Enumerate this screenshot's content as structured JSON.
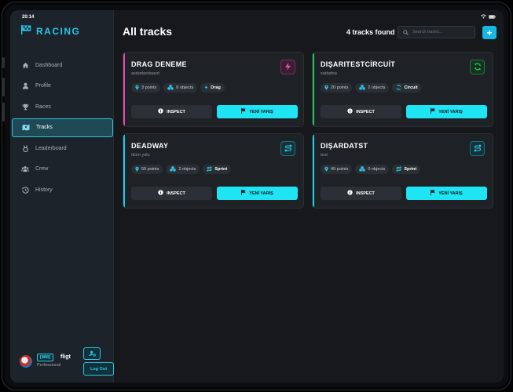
{
  "status": {
    "time": "20:14"
  },
  "brand": {
    "title": "RACING"
  },
  "sidebar": {
    "items": [
      {
        "label": "Dashboard",
        "icon": "home-icon"
      },
      {
        "label": "Profile",
        "icon": "user-icon"
      },
      {
        "label": "Races",
        "icon": "trophy-icon"
      },
      {
        "label": "Tracks",
        "icon": "map-icon",
        "active": true
      },
      {
        "label": "Leaderboard",
        "icon": "medal-icon"
      },
      {
        "label": "Crew",
        "icon": "crew-icon"
      },
      {
        "label": "History",
        "icon": "history-icon"
      }
    ]
  },
  "user": {
    "tag": "[888]",
    "name": "fligt",
    "rank": "Professional",
    "logout_label": "Log Out"
  },
  "header": {
    "title": "All tracks",
    "count_text": "4 tracks found",
    "search_placeholder": "Search tracks...",
    "add_label": "+"
  },
  "tracks": [
    {
      "name": "DRAG DENEME",
      "description": "asdadasdaasd",
      "points": "3 points",
      "objects": "8 objects",
      "type": "Drag",
      "type_icon": "bolt-icon",
      "accent": "#e04bb0"
    },
    {
      "name": "DIŞARITESTCİRCUİT",
      "description": "sadadsa",
      "points": "20 points",
      "objects": "2 objects",
      "type": "Circuit",
      "type_icon": "loop-icon",
      "accent": "#22c55e"
    },
    {
      "name": "DEADWAY",
      "description": "ölüm yolu",
      "points": "59 points",
      "objects": "2 objects",
      "type": "Sprint",
      "type_icon": "route-icon",
      "accent": "#1ecbe8"
    },
    {
      "name": "DIŞARDATST",
      "description": "test",
      "points": "49 points",
      "objects": "0 objects",
      "type": "Sprint",
      "type_icon": "route-icon",
      "accent": "#1ecbe8"
    }
  ],
  "actions": {
    "inspect_label": "INSPECT",
    "new_race_label": "YENİ YARIŞ"
  },
  "colors": {
    "accent": "#1ee4f4",
    "sidebar_bg": "#1d232a",
    "page_bg": "#16181b",
    "card_bg": "#1e2226"
  }
}
